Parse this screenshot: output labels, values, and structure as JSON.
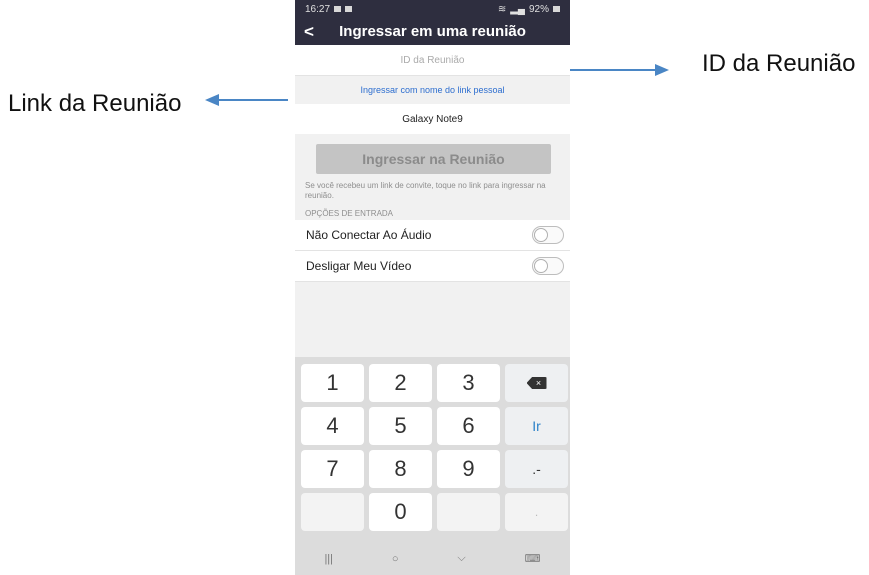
{
  "annotations": {
    "left_label": "Link da Reunião",
    "right_label": "ID da Reunião"
  },
  "status_bar": {
    "time": "16:27",
    "battery": "92%"
  },
  "header": {
    "back_glyph": "<",
    "title": "Ingressar em uma reunião"
  },
  "form": {
    "meeting_id_placeholder": "ID da Reunião",
    "personal_link_label": "Ingressar com nome do link pessoal",
    "display_name": "Galaxy Note9",
    "join_button": "Ingressar na Reunião",
    "hint": "Se você recebeu um link de convite, toque no link para ingressar na reunião."
  },
  "options": {
    "section_title": "OPÇÕES DE ENTRADA",
    "items": [
      {
        "label": "Não Conectar Ao Áudio",
        "enabled": false
      },
      {
        "label": "Desligar Meu Vídeo",
        "enabled": false
      }
    ]
  },
  "keypad": {
    "keys": [
      "1",
      "2",
      "3",
      "4",
      "5",
      "6",
      "7",
      "8",
      "9",
      "0"
    ],
    "go_label": "Ir",
    "symbol_label": ".-",
    "backspace_glyph": "×",
    "dot_label": "."
  },
  "navbar": {
    "recents": "|||",
    "home": "○",
    "back": "⌵",
    "keyboard": "⌨"
  },
  "colors": {
    "header_bg": "#2e2e3f",
    "link_blue": "#2d6ecf",
    "arrow_blue": "#4a86c5",
    "join_disabled": "#c4c4c4"
  }
}
